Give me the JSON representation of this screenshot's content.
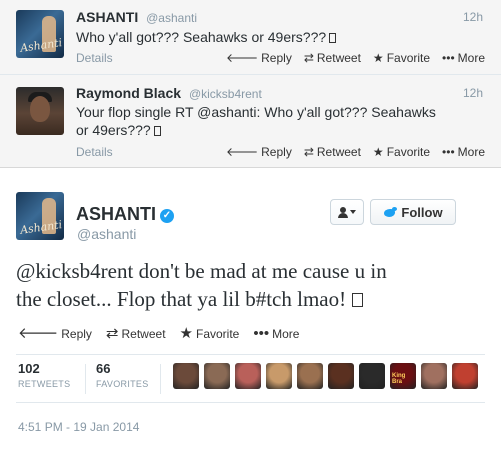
{
  "thread": [
    {
      "name": "ASHANTI",
      "handle": "@ashanti",
      "time": "12h",
      "text": "Who y'all got??? Seahawks or 49ers???",
      "details": "Details",
      "avatar_sig": "Ashanti",
      "actions": {
        "reply": "Reply",
        "retweet": "Retweet",
        "favorite": "Favorite",
        "more": "More"
      }
    },
    {
      "name": "Raymond Black",
      "handle": "@kicksb4rent",
      "time": "12h",
      "text_line1": "Your flop single RT @ashanti: Who y'all got??? Seahawks",
      "text_line2": "or 49ers???",
      "details": "Details",
      "actions": {
        "reply": "Reply",
        "retweet": "Retweet",
        "favorite": "Favorite",
        "more": "More"
      }
    }
  ],
  "main": {
    "name": "ASHANTI",
    "handle": "@ashanti",
    "avatar_sig": "Ashanti",
    "follow_label": "Follow",
    "text_line1": "@kicksb4rent don't be mad at me cause u in",
    "text_line2": "the closet... Flop that ya lil b#tch lmao!",
    "actions": {
      "reply": "Reply",
      "retweet": "Retweet",
      "favorite": "Favorite",
      "more": "More"
    },
    "retweets_count": "102",
    "retweets_label": "RETWEETS",
    "favorites_count": "66",
    "favorites_label": "FAVORITES",
    "favoriters": [
      {
        "name": "favoriter-1",
        "color": "#6b4a3a"
      },
      {
        "name": "favoriter-2",
        "color": "#8a6a55"
      },
      {
        "name": "favoriter-3",
        "color": "#b9605a"
      },
      {
        "name": "favoriter-4",
        "color": "#c89a6a"
      },
      {
        "name": "favoriter-5",
        "color": "#9a7050"
      },
      {
        "name": "favoriter-6",
        "color": "#5a3020"
      },
      {
        "name": "favoriter-7",
        "color": "#2a2a2a"
      },
      {
        "name": "favoriter-8",
        "color": "#6a0f12",
        "text": "King Bra"
      },
      {
        "name": "favoriter-9",
        "color": "#a07060"
      },
      {
        "name": "favoriter-10",
        "color": "#c04030"
      }
    ],
    "timestamp": "4:51 PM - 19 Jan 2014"
  },
  "colors": {
    "verified_blue": "#1da1f2",
    "muted_gray": "#8899a6",
    "thread_bg": "#f5f5f5"
  },
  "icons": [
    "reply-icon",
    "retweet-icon",
    "favorite-star-icon",
    "more-dots-icon",
    "verified-badge-icon",
    "user-dropdown-icon",
    "twitter-bird-icon"
  ]
}
